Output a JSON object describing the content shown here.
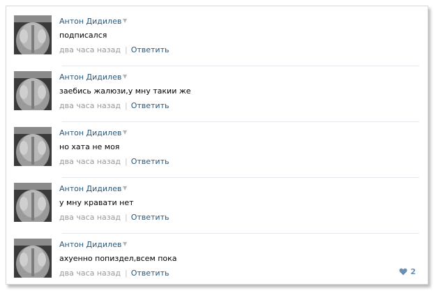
{
  "comments": [
    {
      "author": "Антон Дидилев",
      "text": "подписался",
      "time": "два часа назад",
      "reply": "Ответить"
    },
    {
      "author": "Антон Дидилев",
      "text": "заебись жалюзи,у мну такии же",
      "time": "два часа назад",
      "reply": "Ответить"
    },
    {
      "author": "Антон Дидилев",
      "text": "но хата не моя",
      "time": "два часа назад",
      "reply": "Ответить"
    },
    {
      "author": "Антон Дидилев",
      "text": "у мну кравати нет",
      "time": "два часа назад",
      "reply": "Ответить"
    },
    {
      "author": "Антон Дидилев",
      "text": "ахуенно попиздел,всем пока",
      "time": "два часа назад",
      "reply": "Ответить",
      "likes": "2"
    }
  ],
  "icons": {
    "expand": "caret-down-icon",
    "like": "heart-icon"
  },
  "colors": {
    "link": "#2b587a",
    "meta": "#999999",
    "separator": "#e3e6ea",
    "like": "#6b8fb3"
  }
}
